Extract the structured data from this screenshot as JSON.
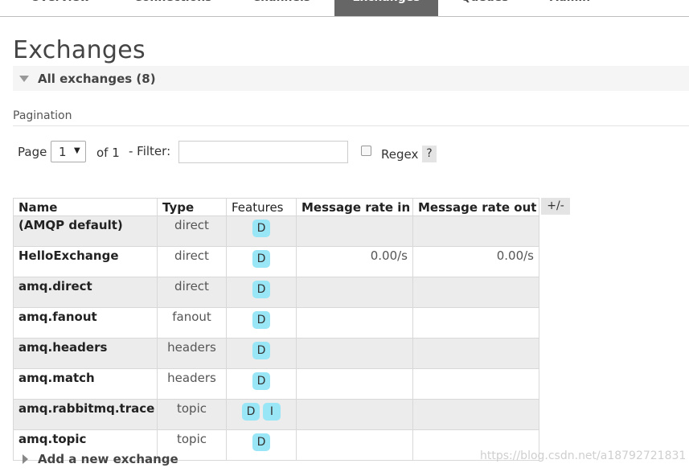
{
  "nav": {
    "tabs": [
      {
        "label": "Overview"
      },
      {
        "label": "Connections"
      },
      {
        "label": "Channels"
      },
      {
        "label": "Exchanges",
        "active": true
      },
      {
        "label": "Queues"
      },
      {
        "label": "Admin"
      }
    ]
  },
  "page": {
    "title": "Exchanges",
    "section_title": "All exchanges (8)"
  },
  "pagination": {
    "label": "Pagination",
    "page_label": "Page",
    "page_value": "1",
    "of_label": "of 1",
    "filter_label": "- Filter:",
    "filter_value": "",
    "regex_label": "Regex",
    "help_label": "?"
  },
  "table": {
    "columns": [
      "Name",
      "Type",
      "Features",
      "Message rate in",
      "Message rate out"
    ],
    "toggle_label": "+/-",
    "rows": [
      {
        "name": "(AMQP default)",
        "type": "direct",
        "features": [
          "D"
        ],
        "rate_in": "",
        "rate_out": ""
      },
      {
        "name": "HelloExchange",
        "type": "direct",
        "features": [
          "D"
        ],
        "rate_in": "0.00/s",
        "rate_out": "0.00/s"
      },
      {
        "name": "amq.direct",
        "type": "direct",
        "features": [
          "D"
        ],
        "rate_in": "",
        "rate_out": ""
      },
      {
        "name": "amq.fanout",
        "type": "fanout",
        "features": [
          "D"
        ],
        "rate_in": "",
        "rate_out": ""
      },
      {
        "name": "amq.headers",
        "type": "headers",
        "features": [
          "D"
        ],
        "rate_in": "",
        "rate_out": ""
      },
      {
        "name": "amq.match",
        "type": "headers",
        "features": [
          "D"
        ],
        "rate_in": "",
        "rate_out": ""
      },
      {
        "name": "amq.rabbitmq.trace",
        "type": "topic",
        "features": [
          "D",
          "I"
        ],
        "rate_in": "",
        "rate_out": ""
      },
      {
        "name": "amq.topic",
        "type": "topic",
        "features": [
          "D"
        ],
        "rate_in": "",
        "rate_out": ""
      }
    ]
  },
  "add_exchange": {
    "label": "Add a new exchange"
  },
  "watermark": "https://blog.csdn.net/a18792721831",
  "colors": {
    "active_tab": "#666666",
    "feature_badge": "#99e6f7",
    "row_alt": "#ececec"
  }
}
